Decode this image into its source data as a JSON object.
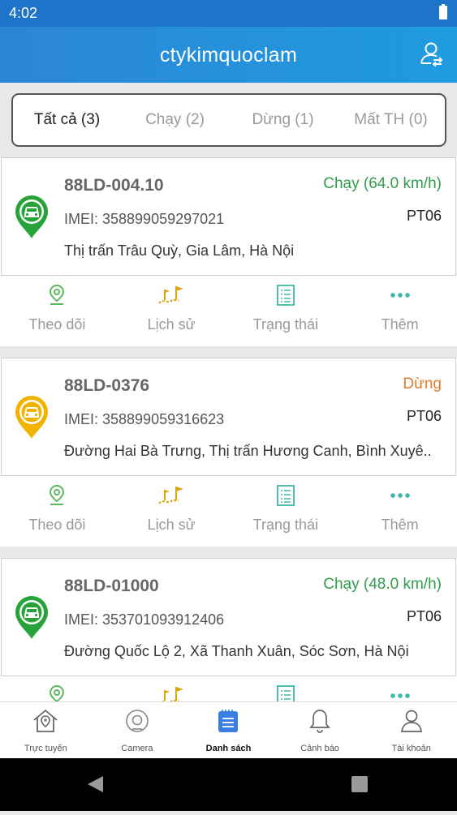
{
  "status_bar": {
    "time": "4:02"
  },
  "app_bar": {
    "title": "ctykimquoclam"
  },
  "filters": [
    {
      "label": "Tất cả (3)",
      "active": true
    },
    {
      "label": "Chạy (2)",
      "active": false
    },
    {
      "label": "Dừng (1)",
      "active": false
    },
    {
      "label": "Mất TH (0)",
      "active": false
    }
  ],
  "vehicles": [
    {
      "plate": "88LD-004.10",
      "status": "Chạy (64.0 km/h)",
      "status_color": "#2e9d4c",
      "pin_color": "#27a33a",
      "imei": "IMEI: 358899059297021",
      "device": "PT06",
      "address": "Thị trấn Trâu Quỳ, Gia Lâm, Hà Nội"
    },
    {
      "plate": "88LD-0376",
      "status": "Dừng",
      "status_color": "#e07b2a",
      "pin_color": "#f0b400",
      "imei": "IMEI: 358899059316623",
      "device": "PT06",
      "address": "Đường Hai Bà Trưng, Thị trấn Hương Canh, Bình Xuyê.."
    },
    {
      "plate": "88LD-01000",
      "status": "Chạy (48.0 km/h)",
      "status_color": "#2e9d4c",
      "pin_color": "#27a33a",
      "imei": "IMEI: 353701093912406",
      "device": "PT06",
      "address": "Đường Quốc Lộ 2, Xã Thanh Xuân, Sóc Sơn, Hà Nội"
    }
  ],
  "actions": {
    "follow": "Theo dõi",
    "history": "Lịch sử",
    "state": "Trạng thái",
    "more": "Thêm"
  },
  "bottom_nav": [
    {
      "label": "Trực tuyến",
      "icon": "home-pin-icon",
      "active": false
    },
    {
      "label": "Camera",
      "icon": "camera-icon",
      "active": false
    },
    {
      "label": "Danh sách",
      "icon": "list-icon",
      "active": true
    },
    {
      "label": "Cảnh báo",
      "icon": "bell-icon",
      "active": false
    },
    {
      "label": "Tài khoản",
      "icon": "user-icon",
      "active": false
    }
  ],
  "colors": {
    "accent": "#1e74c9",
    "green": "#2e9d4c",
    "orange": "#e07b2a",
    "gold": "#d9a514",
    "teal": "#3fb7a8"
  }
}
